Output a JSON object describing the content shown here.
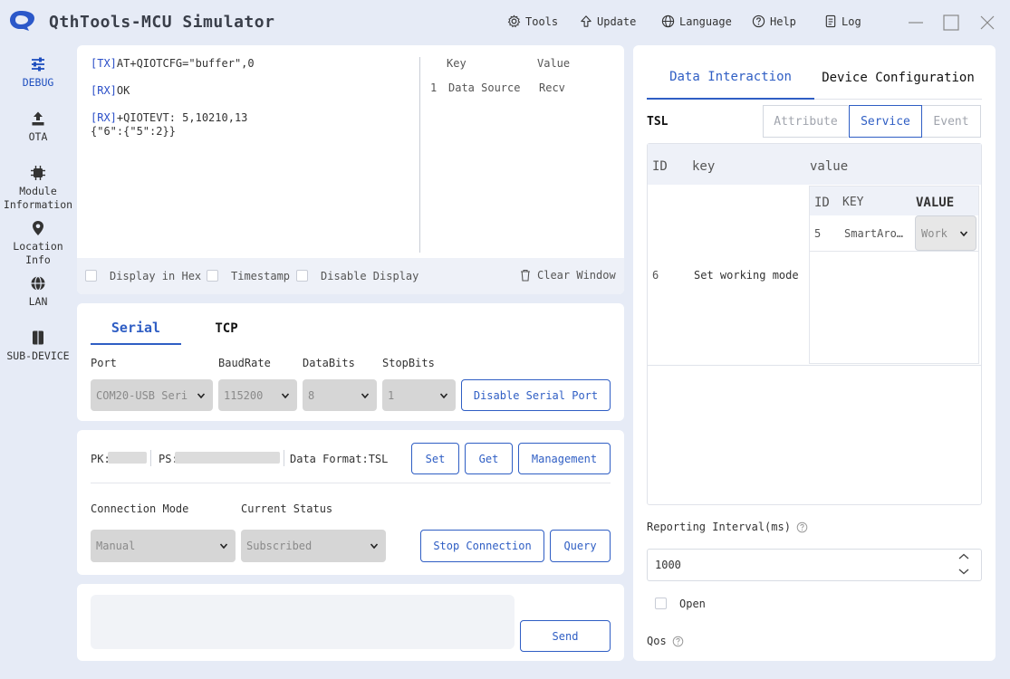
{
  "app": {
    "title": "QthTools-MCU Simulator"
  },
  "menu": {
    "tools": "Tools",
    "update": "Update",
    "language": "Language",
    "help": "Help",
    "log": "Log"
  },
  "sidebar": {
    "items": [
      {
        "label": "DEBUG",
        "icon": "sliders-icon"
      },
      {
        "label": "OTA",
        "icon": "upload-icon"
      },
      {
        "label": "Module Information",
        "icon": "chip-icon"
      },
      {
        "label": "Location Info",
        "icon": "location-pin-icon"
      },
      {
        "label": "LAN",
        "icon": "globe-icon"
      },
      {
        "label": "SUB-DEVICE",
        "icon": "sub-device-icon"
      }
    ]
  },
  "log": {
    "lines": [
      {
        "tag": "[TX]",
        "text": "AT+QIOTCFG=\"buffer\",0"
      },
      {
        "tag": "[RX]",
        "text": "OK"
      },
      {
        "tag": "[RX]",
        "text": "+QIOTEVT: 5,10210,13"
      },
      {
        "tag": "",
        "text": "{\"6\":{\"5\":2}}"
      }
    ],
    "kv_headers": {
      "key": "Key",
      "value": "Value"
    },
    "kv_rows": [
      {
        "index": "1",
        "key": "Data Source",
        "value": "Recv"
      }
    ],
    "options": {
      "hex": "Display in Hex",
      "timestamp": "Timestamp",
      "disable": "Disable Display",
      "clear": "Clear Window"
    }
  },
  "connection_tabs": {
    "serial": "Serial",
    "tcp": "TCP"
  },
  "serial": {
    "port_label": "Port",
    "baud_label": "BaudRate",
    "databits_label": "DataBits",
    "stopbits_label": "StopBits",
    "port_value": "COM20-USB Seri",
    "baud_value": "115200",
    "databits_value": "8",
    "stopbits_value": "1",
    "disable_button": "Disable Serial Port"
  },
  "product": {
    "pk_label": "PK:",
    "ps_label": "PS:",
    "format_label": "Data Format:TSL",
    "set_button": "Set",
    "get_button": "Get",
    "management_button": "Management",
    "mode_label": "Connection Mode",
    "status_label": "Current Status",
    "mode_value": "Manual",
    "status_value": "Subscribed",
    "stop_button": "Stop Connection",
    "query_button": "Query"
  },
  "send": {
    "button": "Send"
  },
  "right": {
    "tab_data": "Data Interaction",
    "tab_config": "Device Configuration",
    "tsl_label": "TSL",
    "seg_attribute": "Attribute",
    "seg_service": "Service",
    "seg_event": "Event",
    "table_headers": {
      "id": "ID",
      "key": "key",
      "value": "value"
    },
    "row": {
      "id": "6",
      "key": "Set working mode"
    },
    "inner_headers": {
      "id": "ID",
      "key": "KEY",
      "value": "VALUE"
    },
    "inner_row": {
      "id": "5",
      "key": "SmartAro…",
      "value": "Work"
    },
    "interval_label": "Reporting Interval(ms)",
    "interval_value": "1000",
    "open_label": "Open",
    "qos_label": "Qos"
  }
}
